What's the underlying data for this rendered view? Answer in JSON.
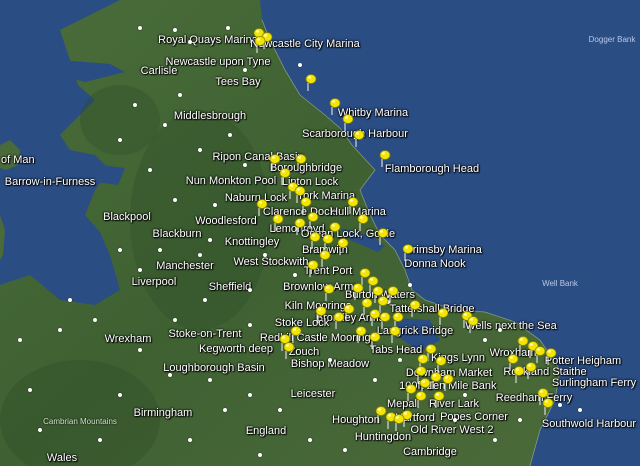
{
  "map": {
    "sea_labels": [
      {
        "id": "dogger-bank",
        "text": "Dogger Bank"
      },
      {
        "id": "well-bank",
        "text": "Well Bank"
      }
    ],
    "place_labels": [
      {
        "id": "royal-quays-marina",
        "text": "Royal Quays Marina"
      },
      {
        "id": "newcastle-city-marina",
        "text": "Newcastle City Marina"
      },
      {
        "id": "newcastle-upon-tyne",
        "text": "Newcastle upon Tyne"
      },
      {
        "id": "carlisle",
        "text": "Carlisle"
      },
      {
        "id": "tees-bay",
        "text": "Tees Bay"
      },
      {
        "id": "middlesbrough",
        "text": "Middlesbrough"
      },
      {
        "id": "whitby-marina",
        "text": "Whitby Marina"
      },
      {
        "id": "scarborough-harbour",
        "text": "Scarborough Harbour"
      },
      {
        "id": "isle-of-man",
        "text": "of Man"
      },
      {
        "id": "ripon-canal-basin",
        "text": "Ripon Canal Basin"
      },
      {
        "id": "boroughbridge",
        "text": "Boroughbridge"
      },
      {
        "id": "flamborough-head",
        "text": "Flamborough Head"
      },
      {
        "id": "nun-monkton-pool",
        "text": "Nun Monkton Pool"
      },
      {
        "id": "linton-lock",
        "text": "Linton Lock"
      },
      {
        "id": "barrow-in-furness",
        "text": "Barrow-in-Furness"
      },
      {
        "id": "naburn-lock",
        "text": "Naburn Lock"
      },
      {
        "id": "york-marina",
        "text": "York Marina"
      },
      {
        "id": "blackpool",
        "text": "Blackpool"
      },
      {
        "id": "clarence-dock",
        "text": "Clarence Dock"
      },
      {
        "id": "hull-marina",
        "text": "Hull Marina"
      },
      {
        "id": "woodlesford",
        "text": "Woodlesford"
      },
      {
        "id": "blackburn",
        "text": "Blackburn"
      },
      {
        "id": "lemonroyd",
        "text": "Lemonroyd"
      },
      {
        "id": "knottingley",
        "text": "Knottingley"
      },
      {
        "id": "ocean-lock-goole",
        "text": "Ocean Lock, Goole"
      },
      {
        "id": "bramwith",
        "text": "Bramwith"
      },
      {
        "id": "grimsby-marina",
        "text": "Grimsby Marina"
      },
      {
        "id": "manchester",
        "text": "Manchester"
      },
      {
        "id": "west-stockwith",
        "text": "West Stockwith"
      },
      {
        "id": "donna-nook",
        "text": "Donna Nook"
      },
      {
        "id": "trent-port",
        "text": "Trent Port"
      },
      {
        "id": "liverpool",
        "text": "Liverpool"
      },
      {
        "id": "sheffield",
        "text": "Sheffield"
      },
      {
        "id": "brownlow-arms",
        "text": "Brownlow Arms"
      },
      {
        "id": "burton-waters",
        "text": "Burton Waters"
      },
      {
        "id": "kiln-moorings",
        "text": "Kiln Moorings"
      },
      {
        "id": "tattershall-bridge",
        "text": "Tattershall Bridge"
      },
      {
        "id": "bromley-arms",
        "text": "Bromley Arms"
      },
      {
        "id": "wrexham",
        "text": "Wrexham"
      },
      {
        "id": "stoke-lock",
        "text": "Stoke Lock"
      },
      {
        "id": "langrick-bridge",
        "text": "Langrick Bridge"
      },
      {
        "id": "wells-next-the-sea",
        "text": "Wells next the Sea"
      },
      {
        "id": "stoke-on-trent",
        "text": "Stoke-on-Trent"
      },
      {
        "id": "redhill-castle-moorings",
        "text": "Redhill Castle Moorings"
      },
      {
        "id": "tabs-head",
        "text": "Tabs Head"
      },
      {
        "id": "kegworth-deep",
        "text": "Kegworth deep"
      },
      {
        "id": "zouch",
        "text": "Zouch"
      },
      {
        "id": "kings-lynn",
        "text": "Kings Lynn"
      },
      {
        "id": "wroxham",
        "text": "Wroxham"
      },
      {
        "id": "potter-heigham",
        "text": "Potter Heigham"
      },
      {
        "id": "bishop-meadow",
        "text": "Bishop Meadow"
      },
      {
        "id": "loughborough-basin",
        "text": "Loughborough Basin"
      },
      {
        "id": "downham-market",
        "text": "Downham Market"
      },
      {
        "id": "rockland-staithe",
        "text": "Rockland Staithe"
      },
      {
        "id": "100ft-2",
        "text": "100ft 2"
      },
      {
        "id": "ten-mile-bank",
        "text": "Ten Mile Bank"
      },
      {
        "id": "surlingham-ferry",
        "text": "Surlingham Ferry"
      },
      {
        "id": "leicester",
        "text": "Leicester"
      },
      {
        "id": "reedham-ferry",
        "text": "Reedham Ferry"
      },
      {
        "id": "birmingham",
        "text": "Birmingham"
      },
      {
        "id": "mepal",
        "text": "Mepal"
      },
      {
        "id": "river-lark",
        "text": "River Lark"
      },
      {
        "id": "houghton",
        "text": "Houghton"
      },
      {
        "id": "hartford",
        "text": "Hartford"
      },
      {
        "id": "popes-corner",
        "text": "Popes Corner"
      },
      {
        "id": "southwold-harbour",
        "text": "Southwold Harbour"
      },
      {
        "id": "england",
        "text": "England"
      },
      {
        "id": "old-river-west-2",
        "text": "Old River West 2"
      },
      {
        "id": "huntingdon",
        "text": "Huntingdon"
      },
      {
        "id": "cambridge",
        "text": "Cambridge"
      },
      {
        "id": "wales",
        "text": "Wales"
      }
    ],
    "terrain_labels": [
      {
        "id": "cambrian-mountains",
        "text": "Cambrian Mountains"
      }
    ],
    "marker_count": 75,
    "marker_color": "#f2e600",
    "land_color": "#3c5f33",
    "sea_color": "#2a4d84"
  }
}
